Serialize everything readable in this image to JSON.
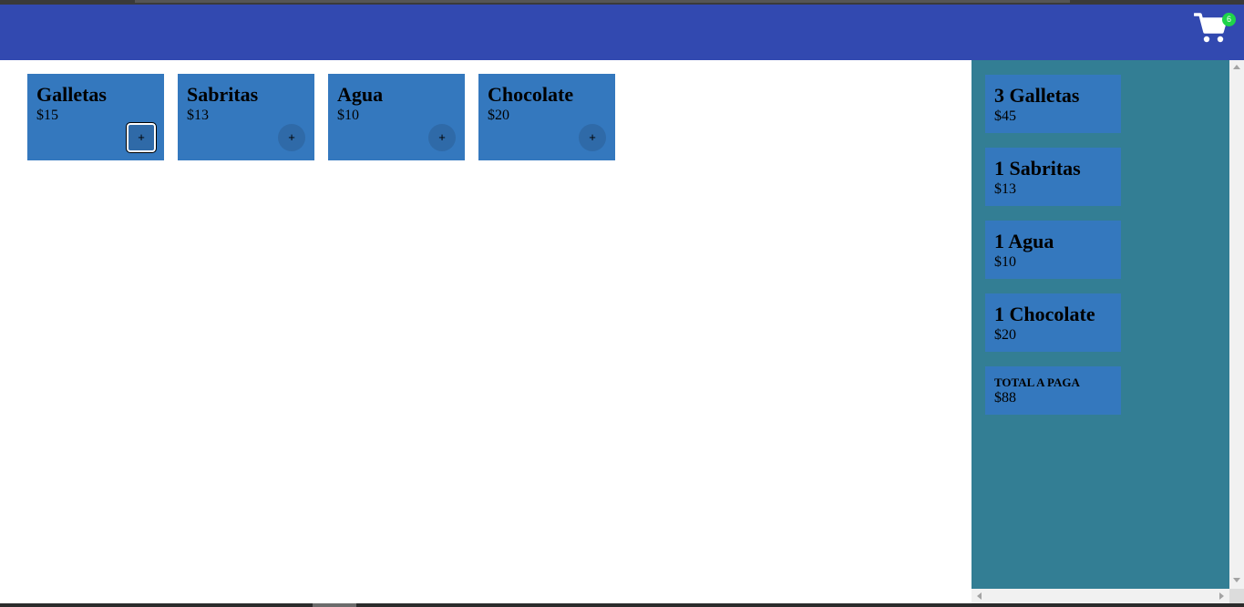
{
  "header": {
    "cart_icon": "shopping-cart-icon",
    "cart_count": "6",
    "background": "#3249b0",
    "badge_color": "#1fd44a"
  },
  "products": [
    {
      "name": "Galletas",
      "price": "$15",
      "add_label": "+"
    },
    {
      "name": "Sabritas",
      "price": "$13",
      "add_label": "+"
    },
    {
      "name": "Agua",
      "price": "$10",
      "add_label": "+"
    },
    {
      "name": "Chocolate",
      "price": "$20",
      "add_label": "+"
    }
  ],
  "cart": {
    "items": [
      {
        "label": "3 Galletas",
        "price": "$45"
      },
      {
        "label": "1 Sabritas",
        "price": "$13"
      },
      {
        "label": "1 Agua",
        "price": "$10"
      },
      {
        "label": "1 Chocolate",
        "price": "$20"
      }
    ],
    "total_label": "TOTAL A PAGA",
    "total_value": "$88",
    "background": "#337e94",
    "card_color": "#3478be"
  }
}
